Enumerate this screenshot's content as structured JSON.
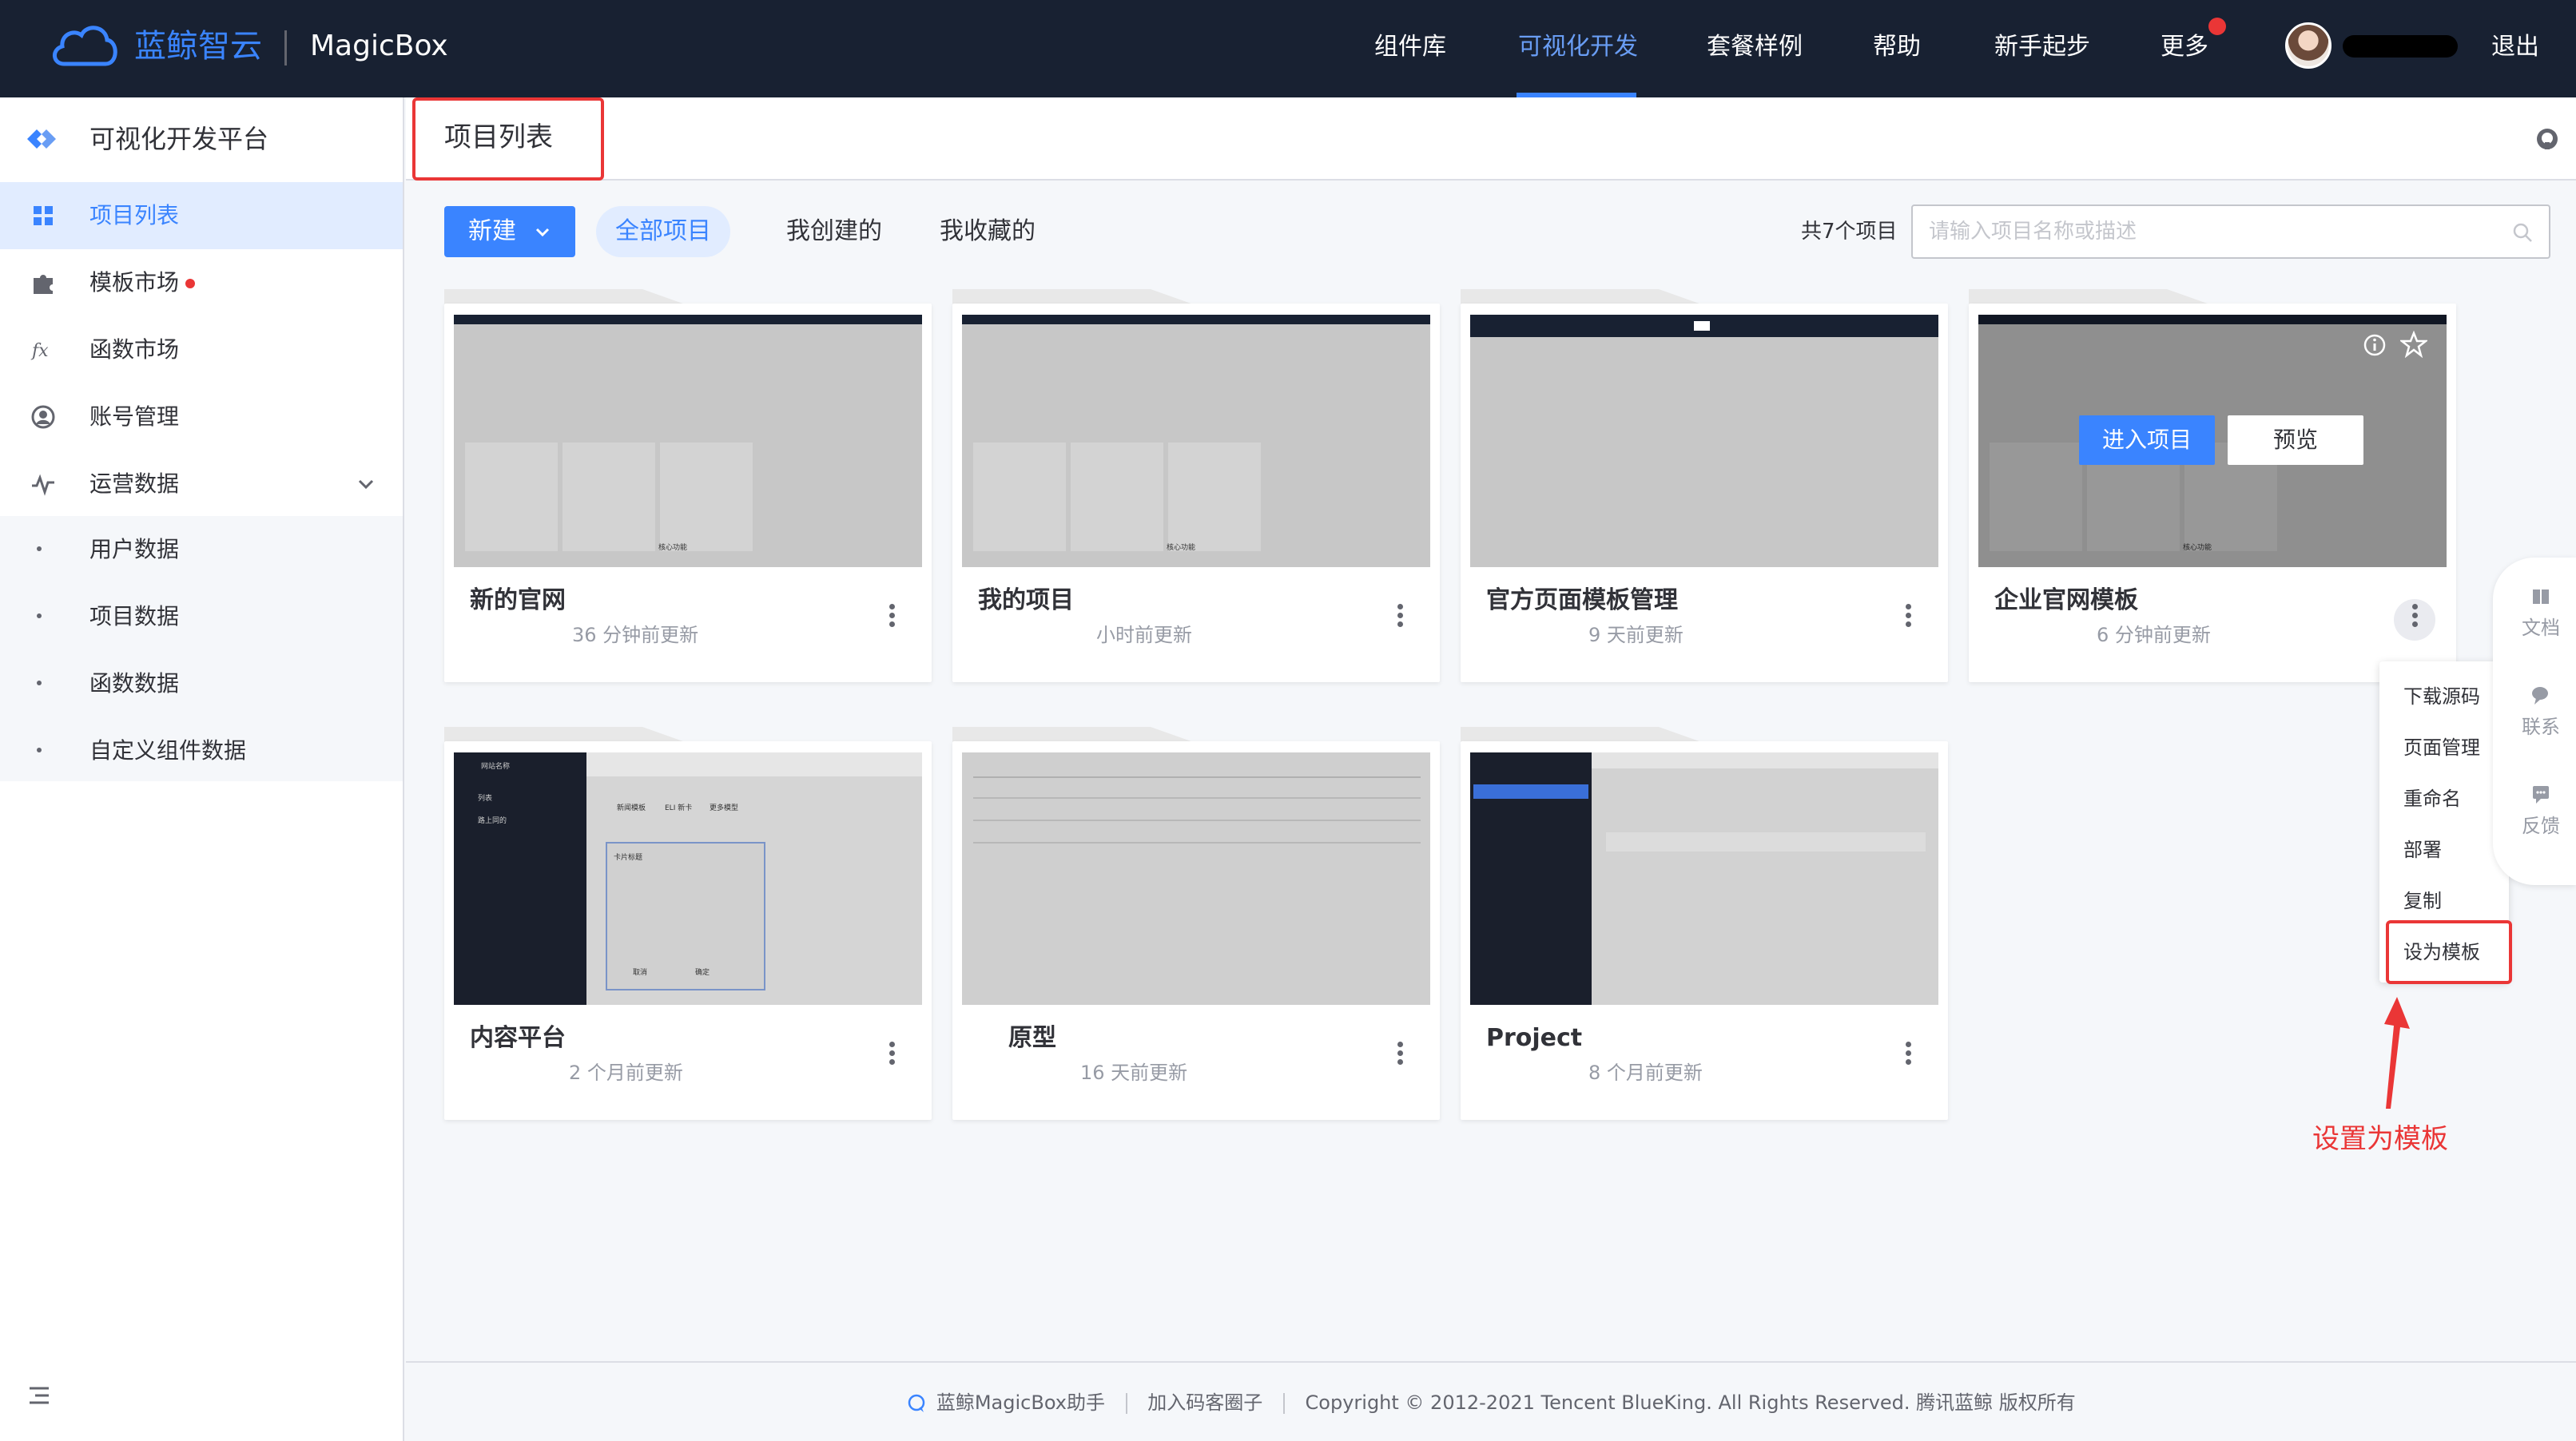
{
  "topnav": {
    "brand": "蓝鲸智云",
    "app_name": "MagicBox",
    "items": [
      {
        "label": "组件库"
      },
      {
        "label": "可视化开发"
      },
      {
        "label": "套餐样例"
      },
      {
        "label": "帮助"
      },
      {
        "label": "新手起步"
      },
      {
        "label": "更多"
      }
    ],
    "logout": "退出"
  },
  "sidebar": {
    "title": "可视化开发平台",
    "items": [
      {
        "label": "项目列表",
        "icon": "grid-icon"
      },
      {
        "label": "模板市场",
        "icon": "puzzle-icon"
      },
      {
        "label": "函数市场",
        "icon": "function-icon"
      },
      {
        "label": "账号管理",
        "icon": "user-circle-icon"
      },
      {
        "label": "运营数据",
        "icon": "chart-icon"
      }
    ],
    "sub_items": [
      {
        "label": "用户数据"
      },
      {
        "label": "项目数据"
      },
      {
        "label": "函数数据"
      },
      {
        "label": "自定义组件数据"
      }
    ]
  },
  "page": {
    "title": "项目列表"
  },
  "toolbar": {
    "new_label": "新建",
    "tabs": [
      {
        "label": "全部项目"
      },
      {
        "label": "我创建的"
      },
      {
        "label": "我收藏的"
      }
    ],
    "total": "共7个项目",
    "search_placeholder": "请输入项目名称或描述"
  },
  "cards": [
    {
      "name": "新的官网",
      "meta": "36 分钟前更新"
    },
    {
      "name": "我的项目",
      "meta": "小时前更新"
    },
    {
      "name": "官方页面模板管理",
      "meta": "9 天前更新"
    },
    {
      "name": "企业官网模板",
      "meta": "6 分钟前更新"
    },
    {
      "name": "内容平台",
      "meta": "2 个月前更新"
    },
    {
      "name": "原型",
      "meta": "16 天前更新"
    },
    {
      "name": "Project",
      "meta": "8 个月前更新"
    }
  ],
  "card_overlay": {
    "enter": "进入项目",
    "preview": "预览"
  },
  "dropdown": {
    "items": [
      {
        "label": "下载源码"
      },
      {
        "label": "页面管理"
      },
      {
        "label": "重命名"
      },
      {
        "label": "部署"
      },
      {
        "label": "复制"
      },
      {
        "label": "设为模板"
      }
    ]
  },
  "annotation": "设置为模板",
  "float_bar": {
    "items": [
      {
        "label": "文档"
      },
      {
        "label": "联系"
      },
      {
        "label": "反馈"
      }
    ]
  },
  "thumb_text": {
    "core": "核心功能",
    "dark_title": "网站名称",
    "nav1": "列表",
    "nav2": "路上同的",
    "tab1": "新闻模板",
    "tab2": "ELI 新卡",
    "tab3": "更多模型",
    "panel_title": "卡片标题",
    "btn1": "取消",
    "btn2": "确定"
  },
  "footer": {
    "assistant": "蓝鲸MagicBox助手",
    "join": "加入码客圈子",
    "copyright": "Copyright © 2012-2021 Tencent BlueKing. All Rights Reserved. 腾讯蓝鲸 版权所有"
  }
}
